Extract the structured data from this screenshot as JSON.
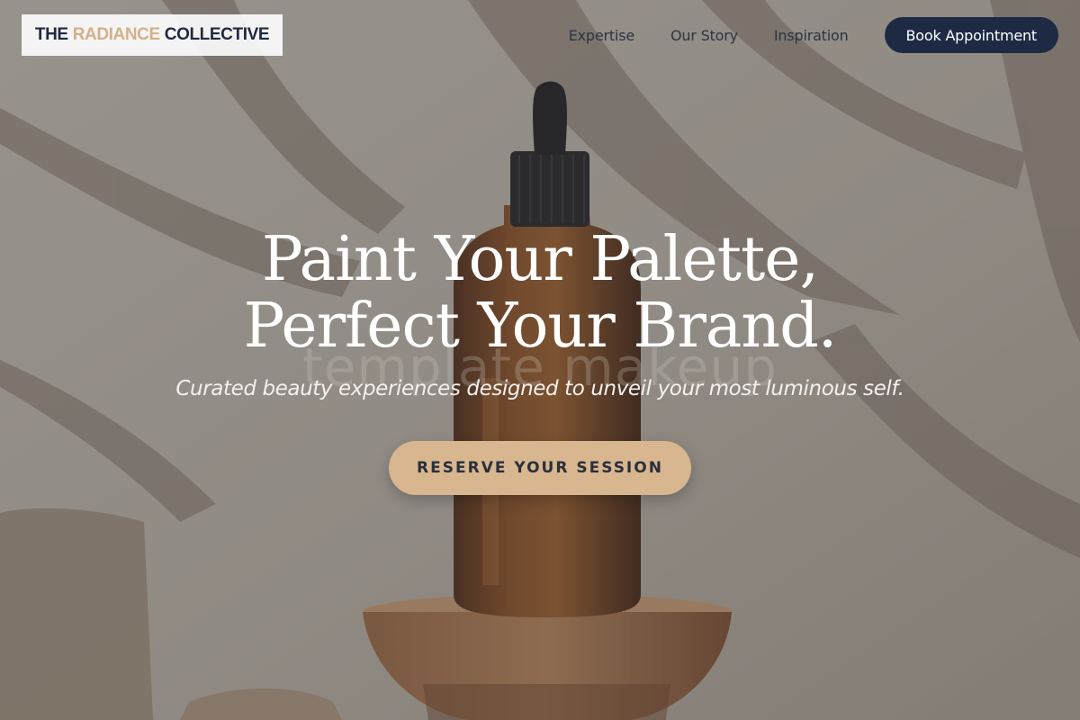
{
  "brand": {
    "name_part1": "THE",
    "name_accent": "RADIANCE",
    "name_part2": "COLLECTIVE"
  },
  "nav": {
    "links": [
      "Expertise",
      "Our Story",
      "Inspiration"
    ],
    "book_button": "Book Appointment"
  },
  "hero": {
    "title_line1": "Paint Your Palette,",
    "title_line2": "Perfect Your Brand.",
    "watermark": "template makeup",
    "subtitle": "Curated beauty experiences designed to unveil your most luminous self.",
    "cta": "RESERVE YOUR SESSION"
  },
  "colors": {
    "navy": "#1e2a44",
    "gold_accent": "#d3b08a",
    "cta_fill": "#d7b690"
  }
}
